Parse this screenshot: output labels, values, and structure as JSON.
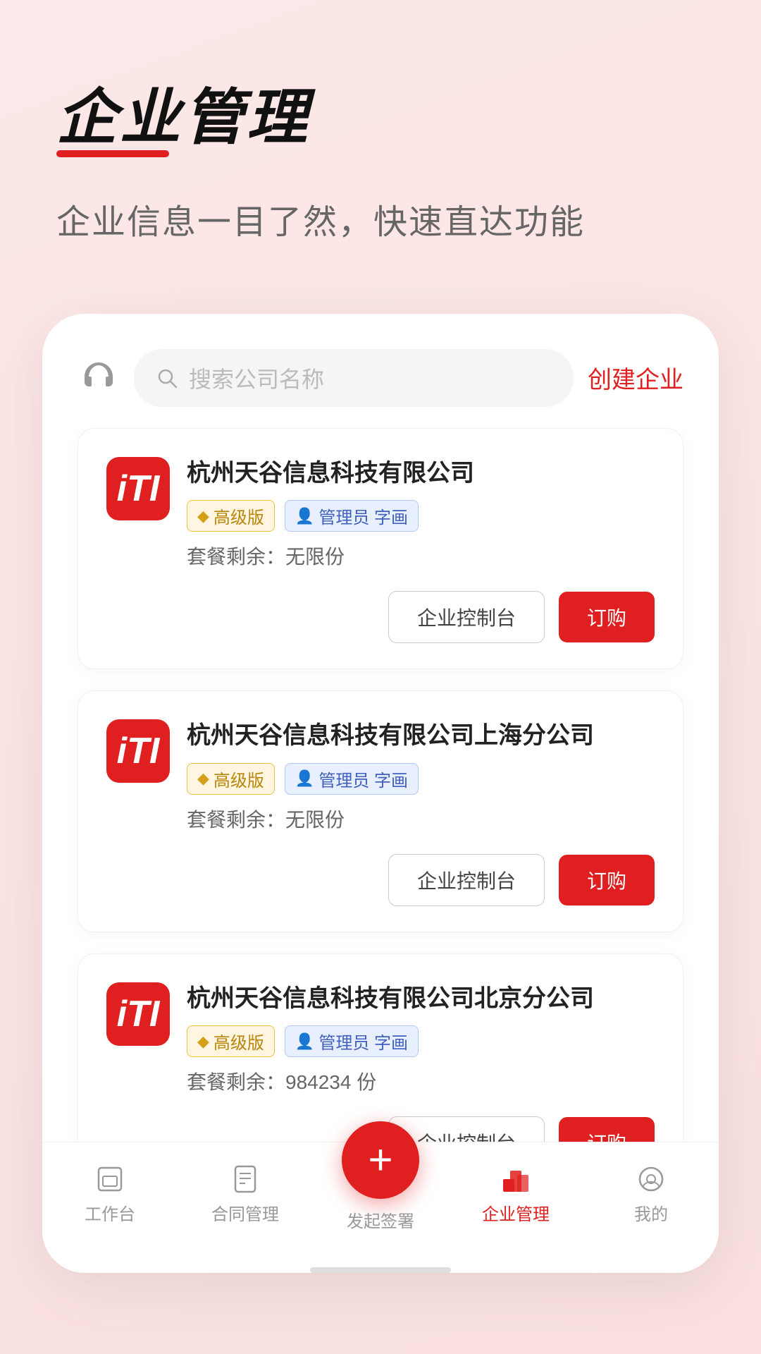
{
  "page": {
    "bg_color": "#fce8e8",
    "title": "企业管理",
    "subtitle": "企业信息一目了然，快速直达功能"
  },
  "search": {
    "placeholder": "搜索公司名称",
    "create_label": "创建企业"
  },
  "companies": [
    {
      "id": 1,
      "name": "杭州天谷信息科技有限公司",
      "logo_letter": "iTI",
      "plan_label": "高级版",
      "admin_label": "管理员 字画",
      "quota_label": "套餐剩余：无限份",
      "btn_control": "企业控制台",
      "btn_order": "订购"
    },
    {
      "id": 2,
      "name": "杭州天谷信息科技有限公司上海分公司",
      "logo_letter": "iTI",
      "plan_label": "高级版",
      "admin_label": "管理员 字画",
      "quota_label": "套餐剩余：无限份",
      "btn_control": "企业控制台",
      "btn_order": "订购"
    },
    {
      "id": 3,
      "name": "杭州天谷信息科技有限公司北京分公司",
      "logo_letter": "iTI",
      "plan_label": "高级版",
      "admin_label": "管理员 字画",
      "quota_label": "套餐剩余：984234 份",
      "btn_control": "企业控制台",
      "btn_order": "订购"
    }
  ],
  "nav": {
    "items": [
      {
        "key": "workbench",
        "label": "工作台",
        "active": false
      },
      {
        "key": "contract",
        "label": "合同管理",
        "active": false
      },
      {
        "key": "sign",
        "label": "发起签署",
        "active": false,
        "fab": true
      },
      {
        "key": "enterprise",
        "label": "企业管理",
        "active": true
      },
      {
        "key": "mine",
        "label": "我的",
        "active": false
      }
    ]
  }
}
